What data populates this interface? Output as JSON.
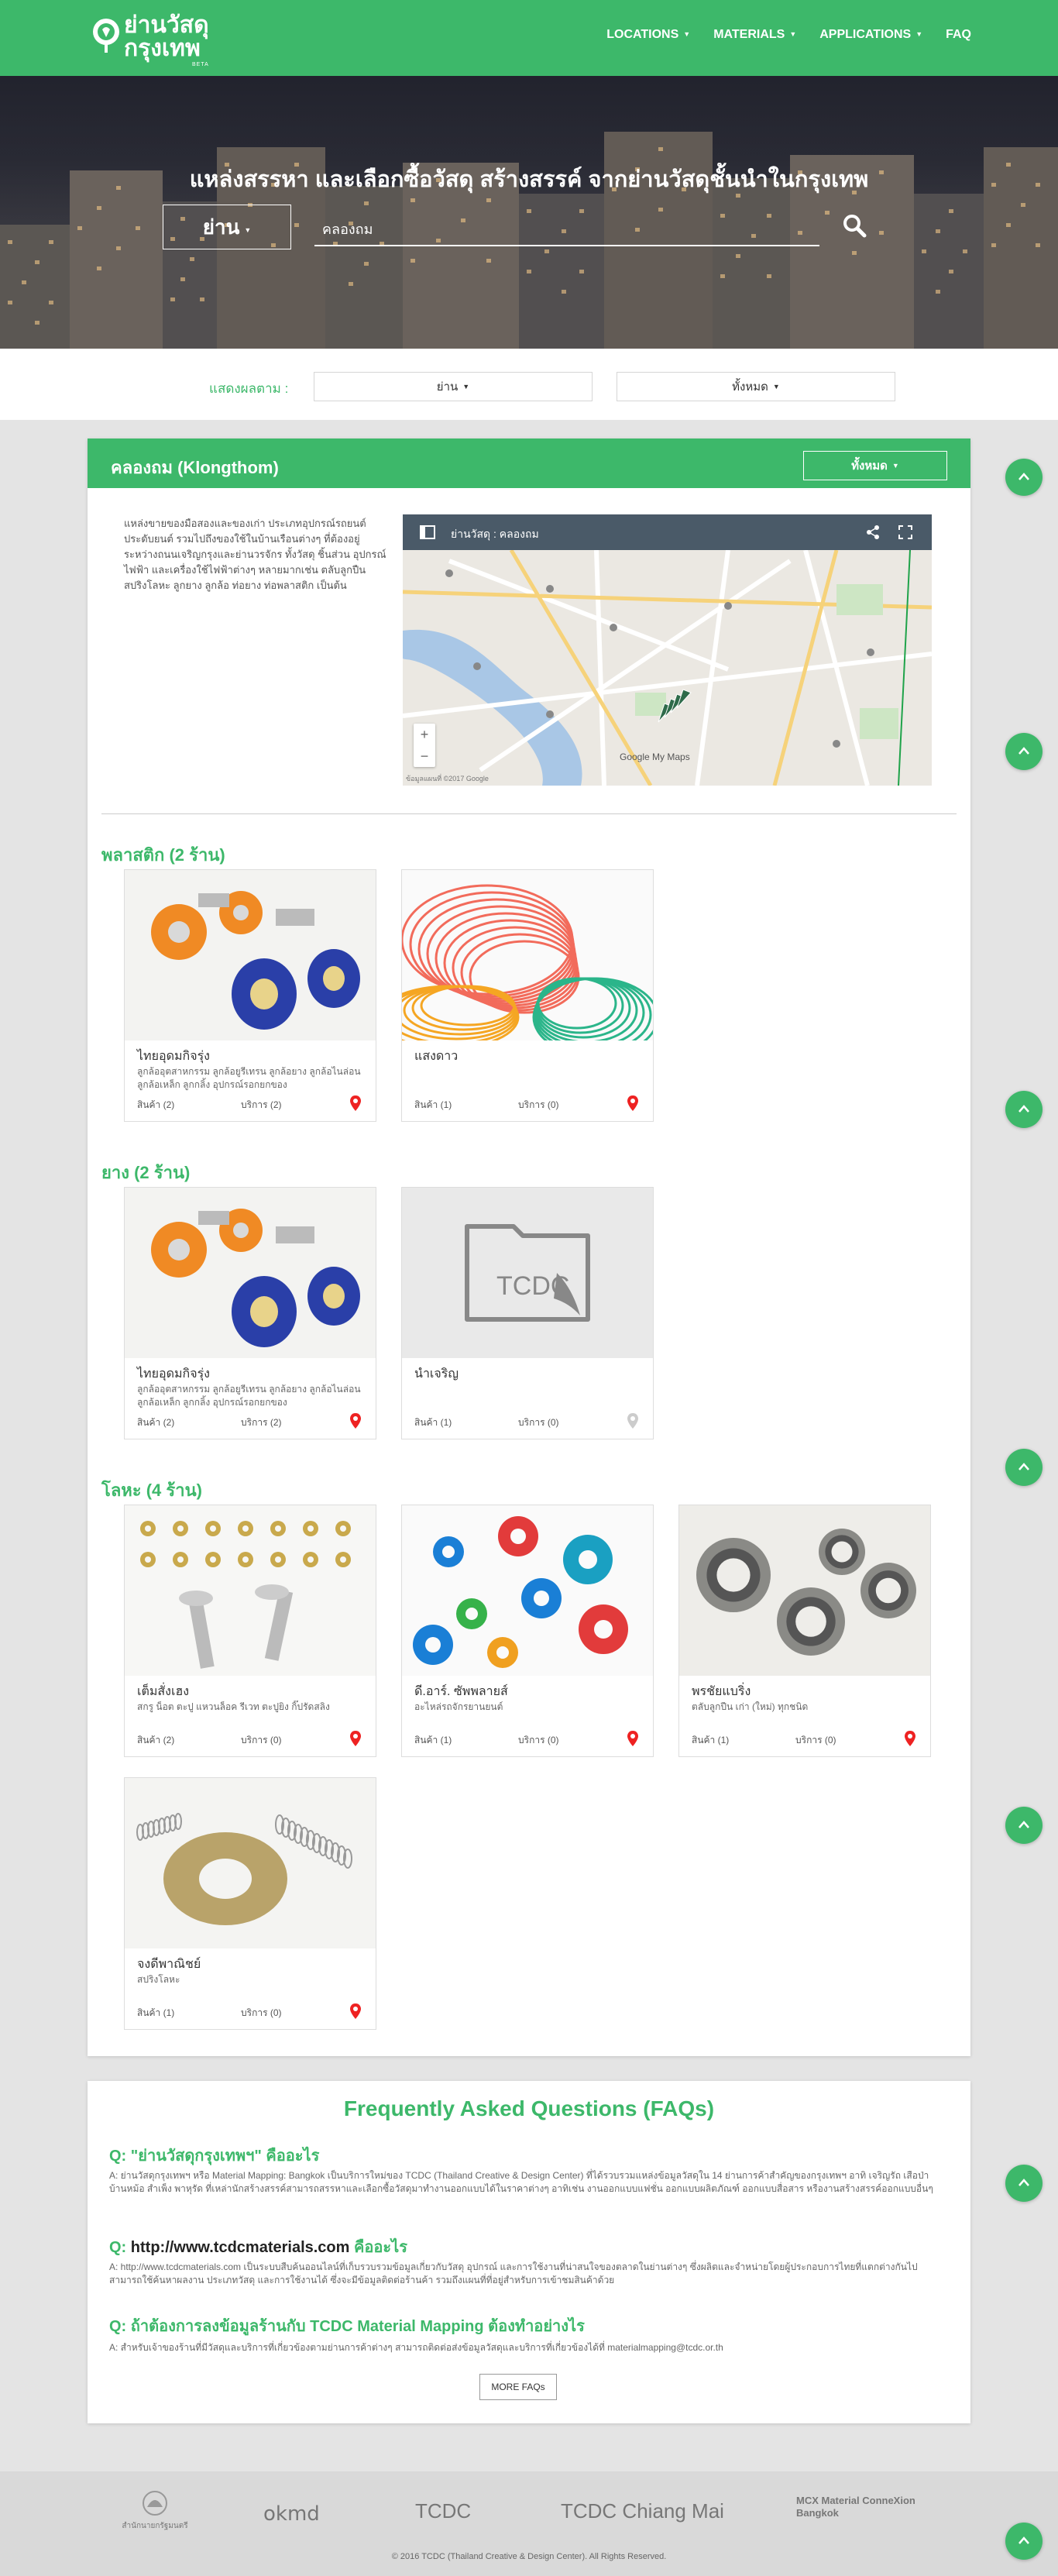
{
  "brand": {
    "line1": "ย่านวัสดุ",
    "line2": "กรุงเทพ",
    "beta": "BETA"
  },
  "nav": {
    "items": [
      {
        "label": "LOCATIONS",
        "caret": true
      },
      {
        "label": "MATERIALS",
        "caret": true
      },
      {
        "label": "APPLICATIONS",
        "caret": true
      },
      {
        "label": "FAQ",
        "caret": false
      }
    ]
  },
  "hero": {
    "title": "แหล่งสรรหา และเลือกซื้อวัสดุ สร้างสรรค์ จากย่านวัสดุชั้นนำในกรุงเทพ",
    "area_button": "ย่าน",
    "search_value": "คลองถม"
  },
  "filter": {
    "label": "แสดงผลตาม :",
    "area_select": "ย่าน",
    "all_select": "ทั้งหมด"
  },
  "district": {
    "title": "คลองถม (Klongthom)",
    "all_button": "ทั้งหมด",
    "description": "แหล่งขายของมือสองและของเก่า ประเภทอุปกรณ์รถยนต์ ประดับยนต์ รวมไปถึงของใช้ในบ้านเรือนต่างๆ ที่ต้องอยู่ระหว่างถนนเจริญกรุงและย่านวรจักร ทั้งวัสดุ ชิ้นส่วน อุปกรณ์ไฟฟ้า และเครื่องใช้ไฟฟ้าต่างๆ หลายมากเช่น ตลับลูกปืน สปริงโลหะ ลูกยาง ลูกล้อ ท่อยาง ท่อพลาสติก เป็นต้น",
    "map": {
      "title": "ย่านวัสดุ : คลองถม",
      "zoom_in": "+",
      "zoom_out": "−",
      "attribution": "Google My Maps",
      "footer_text": "ข้อมูลแผนที่ ©2017 Google"
    }
  },
  "sections": [
    {
      "title": "พลาสติก (2 ร้าน)",
      "shops": [
        {
          "name": "ไทยอุดมกิจรุ่ง",
          "tags": "ลูกล้ออุตสาหกรรม ลูกล้อยูรีเทรน ลูกล้อยาง ลูกล้อไนล่อน ลูกล้อเหล็ก ลูกกลิ้ง อุปกรณ์รอกยกของ",
          "products": "สินค้า (2)",
          "services": "บริการ (2)",
          "image": "casters",
          "pin": "#e22"
        },
        {
          "name": "แสงดาว",
          "tags": "",
          "products": "สินค้า (1)",
          "services": "บริการ (0)",
          "image": "tubes",
          "pin": "#e22"
        }
      ]
    },
    {
      "title": "ยาง (2 ร้าน)",
      "shops": [
        {
          "name": "ไทยอุดมกิจรุ่ง",
          "tags": "ลูกล้ออุตสาหกรรม ลูกล้อยูรีเทรน ลูกล้อยาง ลูกล้อไนล่อน ลูกล้อเหล็ก ลูกกลิ้ง อุปกรณ์รอกยกของ",
          "products": "สินค้า (2)",
          "services": "บริการ (2)",
          "image": "casters",
          "pin": "#e22"
        },
        {
          "name": "นำเจริญ",
          "tags": "",
          "products": "สินค้า (1)",
          "services": "บริการ (0)",
          "image": "placeholder",
          "pin": "#ccc"
        }
      ]
    },
    {
      "title": "โลหะ (4 ร้าน)",
      "shops": [
        {
          "name": "เต็มสั่งเฮง",
          "tags": "สกรู น็อต ตะปู แหวนล็อค รีเวท ตะปูยิง กิ๊ปรัดสลิง",
          "products": "สินค้า (2)",
          "services": "บริการ (0)",
          "image": "screws",
          "pin": "#e22"
        },
        {
          "name": "ดี.อาร์. ซัพพลายส์",
          "tags": "อะไหล่รถจักรยานยนต์",
          "products": "สินค้า (1)",
          "services": "บริการ (0)",
          "image": "washers",
          "pin": "#e22"
        },
        {
          "name": "พรชัยแบริ่ง",
          "tags": "ตลับลูกปืน เก่า (ใหม่) ทุกชนิด",
          "products": "สินค้า (1)",
          "services": "บริการ (0)",
          "image": "bearings",
          "pin": "#e22"
        },
        {
          "name": "จงดีพาณิชย์",
          "tags": "สปริงโลหะ",
          "products": "สินค้า (1)",
          "services": "บริการ (0)",
          "image": "springs",
          "pin": "#e22"
        }
      ]
    }
  ],
  "faq": {
    "title": "Frequently Asked Questions (FAQs)",
    "items": [
      {
        "q_prefix": "Q: ",
        "q_link": "\"ย่านวัสดุกรุงเทพฯ\"",
        "q_suffix": " คืออะไร",
        "a": "A: ย่านวัสดุกรุงเทพฯ หรือ Material Mapping: Bangkok เป็นบริการใหม่ของ TCDC (Thailand Creative & Design Center) ที่ได้รวบรวมแหล่งข้อมูลวัสดุใน 14 ย่านการค้าสำคัญของกรุงเทพฯ อาทิ เจริญรัถ เสือป่า บ้านหม้อ สำเพ็ง พาหุรัด ที่เหล่านักสร้างสรรค์สามารถสรรหาและเลือกซื้อวัสดุมาทำงานออกแบบได้ในราคาต่างๆ อาทิเช่น งานออกแบบแฟชั่น ออกแบบผลิตภัณฑ์ ออกแบบสื่อสาร หรืองานสร้างสรรค์ออกแบบอื่นๆ"
      },
      {
        "q_prefix": "Q: ",
        "q_link": "http://www.tcdcmaterials.com",
        "q_suffix": " คืออะไร",
        "a": "A: http://www.tcdcmaterials.com เป็นระบบสืบค้นออนไลน์ที่เก็บรวบรวมข้อมูลเกี่ยวกับวัสดุ อุปกรณ์ และการใช้งานที่น่าสนใจของตลาดในย่านต่างๆ ซึ่งผลิตและจำหน่ายโดยผู้ประกอบการไทยที่แตกต่างกันไป สามารถใช้ค้นหาผลงาน ประเภทวัสดุ และการใช้งานได้ ซึ่งจะมีข้อมูลติดต่อร้านค้า รวมถึงแผนที่ที่อยู่สำหรับการเข้าชมสินค้าด้วย"
      },
      {
        "q_prefix": "Q: ",
        "q_link": "",
        "q_suffix": "ถ้าต้องการลงข้อมูลร้านกับ TCDC Material Mapping ต้องทำอย่างไร",
        "a": "A: สำหรับเจ้าของร้านที่มีวัสดุและบริการที่เกี่ยวข้องตามย่านการค้าต่างๆ สามารถติดต่อส่งข้อมูลวัสดุและบริการที่เกี่ยวข้องได้ที่ materialmapping@tcdc.or.th"
      }
    ],
    "more_button": "MORE FAQs"
  },
  "footer": {
    "logos": [
      {
        "label": "สำนักนายกรัฐมนตรี"
      },
      {
        "label": "okmd"
      },
      {
        "label": "TCDC"
      },
      {
        "label": "TCDC Chiang Mai"
      },
      {
        "label": "MCX Material ConneXion Bangkok"
      }
    ],
    "copyright": "© 2016 TCDC (Thailand Creative & Design Center). All Rights Reserved."
  },
  "colors": {
    "brand_green": "#3db86a",
    "pin_red": "#e22",
    "pin_inactive": "#ccc"
  }
}
